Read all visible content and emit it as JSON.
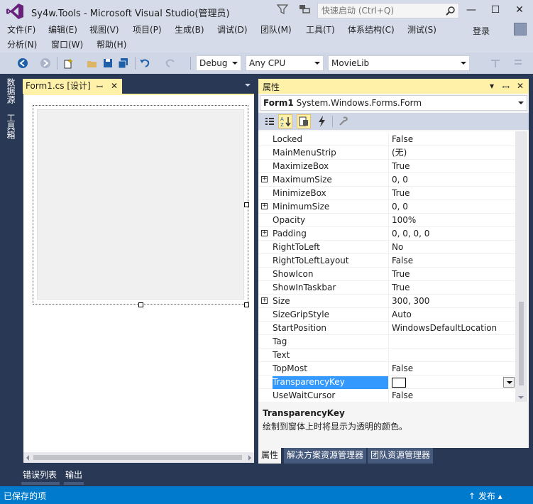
{
  "window": {
    "title": "Sy4w.Tools - Microsoft Visual Studio(管理员)",
    "quick_launch_placeholder": "快速启动 (Ctrl+Q)",
    "minimize": "—",
    "maximize": "☐",
    "close": "✕"
  },
  "menu": {
    "row1": [
      "文件(F)",
      "编辑(E)",
      "视图(V)",
      "项目(P)",
      "生成(B)",
      "调试(D)",
      "团队(M)",
      "工具(T)",
      "体系结构(C)",
      "测试(S)"
    ],
    "row2": [
      "分析(N)",
      "窗口(W)",
      "帮助(H)"
    ],
    "login": "登录"
  },
  "toolbar": {
    "config": "Debug",
    "platform": "Any CPU",
    "project": "MovieLib"
  },
  "left_tabs": [
    "数据源",
    "工具箱"
  ],
  "document": {
    "tab_label": "Form1.cs [设计]",
    "pin": "ꟷ",
    "close": "✕"
  },
  "bottom_tabs": [
    "错误列表",
    "输出"
  ],
  "properties": {
    "title": "属性",
    "object_name": "Form1",
    "object_type": "System.Windows.Forms.Form",
    "rows": [
      {
        "name": "Locked",
        "value": "False",
        "expandable": false
      },
      {
        "name": "MainMenuStrip",
        "value": "(无)",
        "expandable": false
      },
      {
        "name": "MaximizeBox",
        "value": "True",
        "expandable": false
      },
      {
        "name": "MaximumSize",
        "value": "0, 0",
        "expandable": true
      },
      {
        "name": "MinimizeBox",
        "value": "True",
        "expandable": false
      },
      {
        "name": "MinimumSize",
        "value": "0, 0",
        "expandable": true
      },
      {
        "name": "Opacity",
        "value": "100%",
        "expandable": false
      },
      {
        "name": "Padding",
        "value": "0, 0, 0, 0",
        "expandable": true
      },
      {
        "name": "RightToLeft",
        "value": "No",
        "expandable": false
      },
      {
        "name": "RightToLeftLayout",
        "value": "False",
        "expandable": false
      },
      {
        "name": "ShowIcon",
        "value": "True",
        "expandable": false
      },
      {
        "name": "ShowInTaskbar",
        "value": "True",
        "expandable": false
      },
      {
        "name": "Size",
        "value": "300, 300",
        "expandable": true
      },
      {
        "name": "SizeGripStyle",
        "value": "Auto",
        "expandable": false
      },
      {
        "name": "StartPosition",
        "value": "WindowsDefaultLocation",
        "expandable": false
      },
      {
        "name": "Tag",
        "value": "",
        "expandable": false
      },
      {
        "name": "Text",
        "value": "",
        "expandable": false
      },
      {
        "name": "TopMost",
        "value": "False",
        "expandable": false
      },
      {
        "name": "TransparencyKey",
        "value": "",
        "expandable": false,
        "selected": true
      },
      {
        "name": "UseWaitCursor",
        "value": "False",
        "expandable": false
      }
    ],
    "description_title": "TransparencyKey",
    "description_text": "绘制到窗体上时将显示为透明的颜色。",
    "tabs": [
      "属性",
      "解决方案资源管理器",
      "团队资源管理器"
    ]
  },
  "status": {
    "text": "已保存的项",
    "publish": "↑ 发布 ▴"
  },
  "colors": {
    "accent": "#007acc",
    "active_tab": "#fff1a8",
    "selection": "#3399ff",
    "frame": "#293955"
  }
}
